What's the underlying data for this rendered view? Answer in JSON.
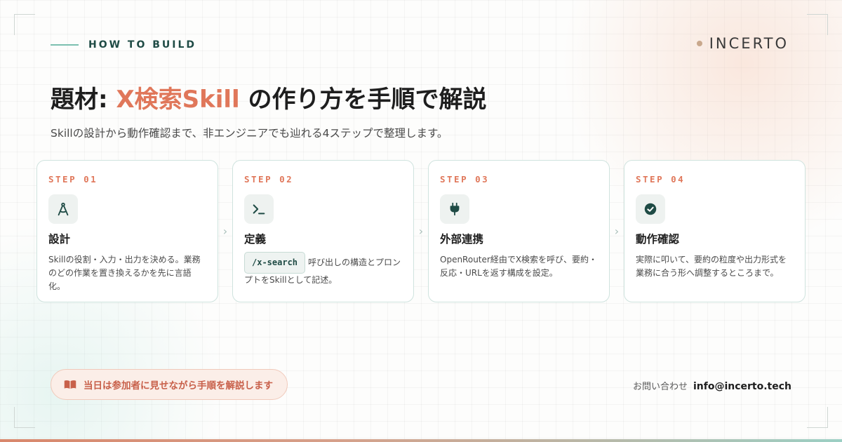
{
  "eyebrow": {
    "text": "HOW TO BUILD"
  },
  "logo": {
    "text": "INCERTO"
  },
  "headline": {
    "prefix": "題材: ",
    "accent": "X検索Skill",
    "suffix": " の作り方を手順で解説"
  },
  "subheadline": "Skillの設計から動作確認まで、非エンジニアでも辿れる4ステップで整理します。",
  "steps": [
    {
      "label": "STEP 01",
      "icon": "compass-icon",
      "title": "設計",
      "desc": "Skillの役割・入力・出力を決める。業務のどの作業を置き換えるかを先に言語化。"
    },
    {
      "label": "STEP 02",
      "icon": "terminal-icon",
      "title": "定義",
      "code": "/x-search",
      "desc": "呼び出しの構造とプロンプトをSkillとして記述。"
    },
    {
      "label": "STEP 03",
      "icon": "plug-icon",
      "title": "外部連携",
      "desc": "OpenRouter経由でX検索を呼び、要約・反応・URLを返す構成を設定。"
    },
    {
      "label": "STEP 04",
      "icon": "check-circle-icon",
      "title": "動作確認",
      "desc": "実際に叩いて、要約の粒度や出力形式を業務に合う形へ調整するところまで。"
    }
  ],
  "notice": {
    "icon": "book-icon",
    "text": "当日は参加者に見せながら手順を解説します"
  },
  "contact": {
    "label": "お問い合わせ",
    "email": "info@incerto.tech"
  },
  "colors": {
    "accent": "#e0775a",
    "brand_dark": "#1f4b45",
    "teal_line": "#7cc0b0"
  }
}
